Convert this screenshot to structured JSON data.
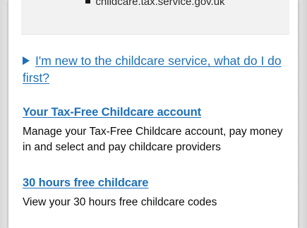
{
  "browser": {
    "url": "childcare.tax.service.gov.uk"
  },
  "details": {
    "summary": "I'm new to the childcare service, what do I do first?"
  },
  "sections": [
    {
      "link": "Your Tax-Free Childcare account",
      "description": "Manage your Tax-Free Childcare account, pay money in and select and pay childcare providers"
    },
    {
      "link": "30 hours free childcare",
      "description": "View your 30 hours free childcare codes"
    }
  ],
  "colors": {
    "link": "#1d70b8",
    "text": "#0b0c0c"
  }
}
